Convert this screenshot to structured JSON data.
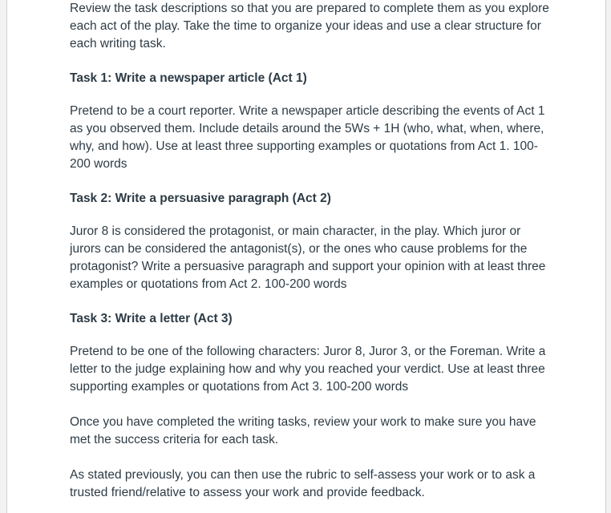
{
  "intro": "Review the task descriptions so that you are prepared to complete them as you explore each act of the play. Take the time to organize your ideas and use a clear structure for each writing task.",
  "tasks": [
    {
      "heading": "Task 1: Write a newspaper article (Act 1)",
      "body": "Pretend to be a court reporter. Write a newspaper article describing the events of Act 1 as you observed them. Include details around the 5Ws + 1H (who, what, when, where, why, and how). Use at least three supporting examples or quotations from Act 1. 100-200 words"
    },
    {
      "heading": "Task 2: Write a persuasive paragraph (Act 2)",
      "body": "Juror 8 is considered the protagonist, or main character, in the play. Which juror or jurors can be considered the antagonist(s), or the ones who cause problems for the protagonist? Write a persuasive paragraph and support your opinion with at least three examples or quotations from Act 2. 100-200 words"
    },
    {
      "heading": "Task 3: Write a letter (Act 3)",
      "body": "Pretend to be one of the following characters: Juror 8, Juror 3, or the Foreman. Write a letter to the judge explaining how and why you reached your verdict. Use at least three supporting examples or quotations from Act 3. 100-200 words"
    }
  ],
  "review": "Once you have completed the writing tasks, review your work to make sure you have met the success criteria for each task.",
  "closing": "As stated previously, you can then use the rubric to self-assess your work or to ask a trusted friend/relative to assess your work and provide feedback."
}
